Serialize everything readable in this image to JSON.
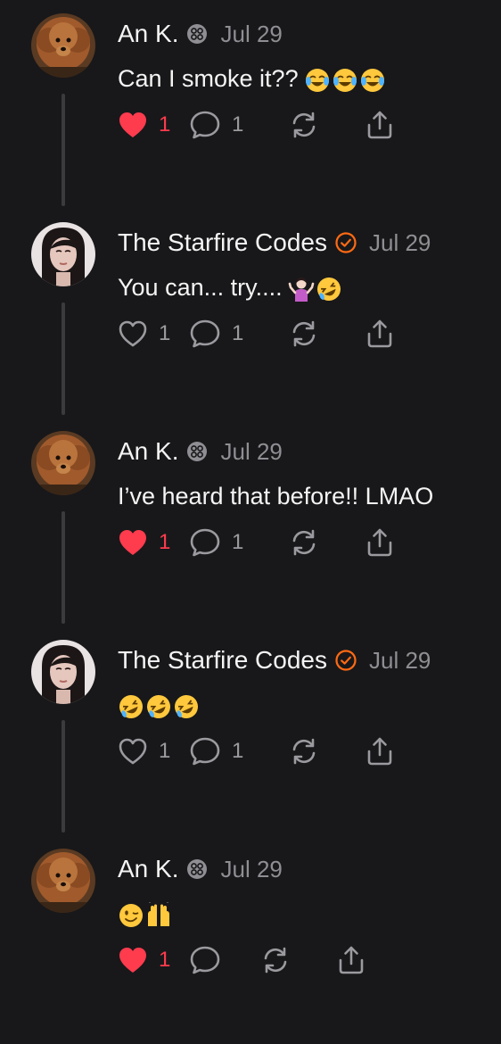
{
  "comments": [
    {
      "author": "An K.",
      "badge": "crossed-circle-badge-icon",
      "date": "Jul 29",
      "text": "Can I smoke it??",
      "emojis": [
        "tears-of-joy",
        "tears-of-joy",
        "tears-of-joy"
      ],
      "liked": true,
      "likes": "1",
      "replies": "1",
      "avatar": "dog"
    },
    {
      "author": "The Starfire Codes",
      "badge": "verified-check-icon",
      "date": "Jul 29",
      "text": "You can... try....",
      "emojis": [
        "person-shrugging",
        "rolling-laughing"
      ],
      "liked": false,
      "likes": "1",
      "replies": "1",
      "avatar": "woman"
    },
    {
      "author": "An K.",
      "badge": "crossed-circle-badge-icon",
      "date": "Jul 29",
      "text": "I’ve heard that before!! LMAO",
      "emojis": [],
      "liked": true,
      "likes": "1",
      "replies": "1",
      "avatar": "dog"
    },
    {
      "author": "The Starfire Codes",
      "badge": "verified-check-icon",
      "date": "Jul 29",
      "text": "",
      "emojis": [
        "rolling-laughing",
        "rolling-laughing",
        "rolling-laughing"
      ],
      "liked": false,
      "likes": "1",
      "replies": "1",
      "avatar": "woman"
    },
    {
      "author": "An K.",
      "badge": "crossed-circle-badge-icon",
      "date": "Jul 29",
      "text": "",
      "emojis": [
        "winking-face",
        "raising-hands"
      ],
      "liked": true,
      "likes": "1",
      "replies": "",
      "avatar": "dog"
    }
  ],
  "colors": {
    "background": "#18181a",
    "liked": "#ff3b4e",
    "muted": "#8e8e93",
    "verified": "#ff6a13"
  }
}
